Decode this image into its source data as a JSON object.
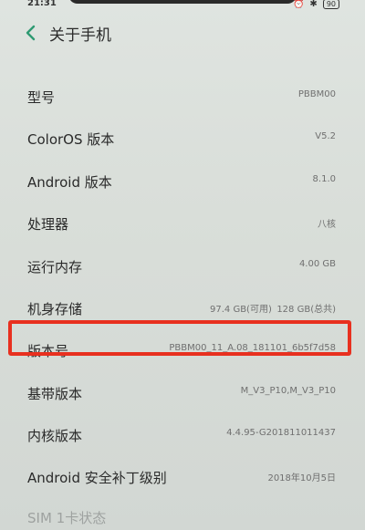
{
  "status": {
    "time": "21:31",
    "battery": "90"
  },
  "header": {
    "title": "关于手机"
  },
  "rows": [
    {
      "label": "型号",
      "value": "PBBM00"
    },
    {
      "label": "ColorOS 版本",
      "value": "V5.2"
    },
    {
      "label": "Android 版本",
      "value": "8.1.0"
    },
    {
      "label": "处理器",
      "value": "八核"
    },
    {
      "label": "运行内存",
      "value": "4.00 GB"
    },
    {
      "label": "机身存储",
      "value_available": "97.4 GB(可用)",
      "value_total": "128 GB(总共)"
    },
    {
      "label": "版本号",
      "value": "PBBM00_11_A.08_181101_6b5f7d58"
    },
    {
      "label": "基带版本",
      "value": "M_V3_P10,M_V3_P10"
    },
    {
      "label": "内核版本",
      "value": "4.4.95-G201811011437"
    },
    {
      "label": "Android 安全补丁级别",
      "value": "2018年10月5日"
    },
    {
      "label": "SIM 1卡状态",
      "value": ""
    }
  ],
  "colors": {
    "highlight": "#e8301f",
    "accent_back": "#2e9a72"
  }
}
